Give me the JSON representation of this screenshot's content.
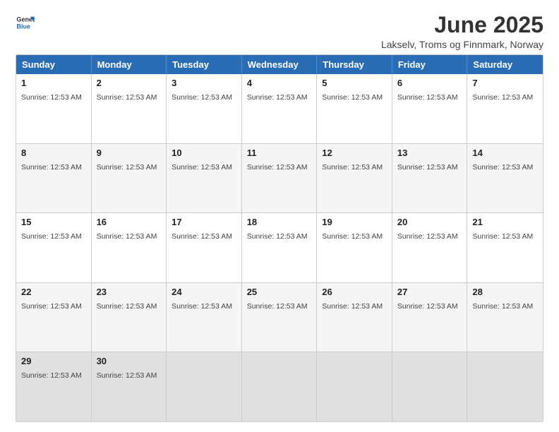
{
  "logo": {
    "line1": "General",
    "line2": "Blue"
  },
  "header": {
    "month_year": "June 2025",
    "location": "Lakselv, Troms og Finnmark, Norway"
  },
  "days_of_week": [
    "Sunday",
    "Monday",
    "Tuesday",
    "Wednesday",
    "Thursday",
    "Friday",
    "Saturday"
  ],
  "sunrise_time": "Sunrise: 12:53 AM",
  "weeks": [
    [
      {
        "day": "1",
        "sunrise": "Sunrise: 12:53 AM"
      },
      {
        "day": "2",
        "sunrise": "Sunrise: 12:53 AM"
      },
      {
        "day": "3",
        "sunrise": "Sunrise: 12:53 AM"
      },
      {
        "day": "4",
        "sunrise": "Sunrise: 12:53 AM"
      },
      {
        "day": "5",
        "sunrise": "Sunrise: 12:53 AM"
      },
      {
        "day": "6",
        "sunrise": "Sunrise: 12:53 AM"
      },
      {
        "day": "7",
        "sunrise": "Sunrise: 12:53 AM"
      }
    ],
    [
      {
        "day": "8",
        "sunrise": "Sunrise: 12:53 AM"
      },
      {
        "day": "9",
        "sunrise": "Sunrise: 12:53 AM"
      },
      {
        "day": "10",
        "sunrise": "Sunrise: 12:53 AM"
      },
      {
        "day": "11",
        "sunrise": "Sunrise: 12:53 AM"
      },
      {
        "day": "12",
        "sunrise": "Sunrise: 12:53 AM"
      },
      {
        "day": "13",
        "sunrise": "Sunrise: 12:53 AM"
      },
      {
        "day": "14",
        "sunrise": "Sunrise: 12:53 AM"
      }
    ],
    [
      {
        "day": "15",
        "sunrise": "Sunrise: 12:53 AM"
      },
      {
        "day": "16",
        "sunrise": "Sunrise: 12:53 AM"
      },
      {
        "day": "17",
        "sunrise": "Sunrise: 12:53 AM"
      },
      {
        "day": "18",
        "sunrise": "Sunrise: 12:53 AM"
      },
      {
        "day": "19",
        "sunrise": "Sunrise: 12:53 AM"
      },
      {
        "day": "20",
        "sunrise": "Sunrise: 12:53 AM"
      },
      {
        "day": "21",
        "sunrise": "Sunrise: 12:53 AM"
      }
    ],
    [
      {
        "day": "22",
        "sunrise": "Sunrise: 12:53 AM"
      },
      {
        "day": "23",
        "sunrise": "Sunrise: 12:53 AM"
      },
      {
        "day": "24",
        "sunrise": "Sunrise: 12:53 AM"
      },
      {
        "day": "25",
        "sunrise": "Sunrise: 12:53 AM"
      },
      {
        "day": "26",
        "sunrise": "Sunrise: 12:53 AM"
      },
      {
        "day": "27",
        "sunrise": "Sunrise: 12:53 AM"
      },
      {
        "day": "28",
        "sunrise": "Sunrise: 12:53 AM"
      }
    ],
    [
      {
        "day": "29",
        "sunrise": "Sunrise: 12:53 AM"
      },
      {
        "day": "30",
        "sunrise": "Sunrise: 12:53 AM"
      },
      null,
      null,
      null,
      null,
      null
    ]
  ]
}
